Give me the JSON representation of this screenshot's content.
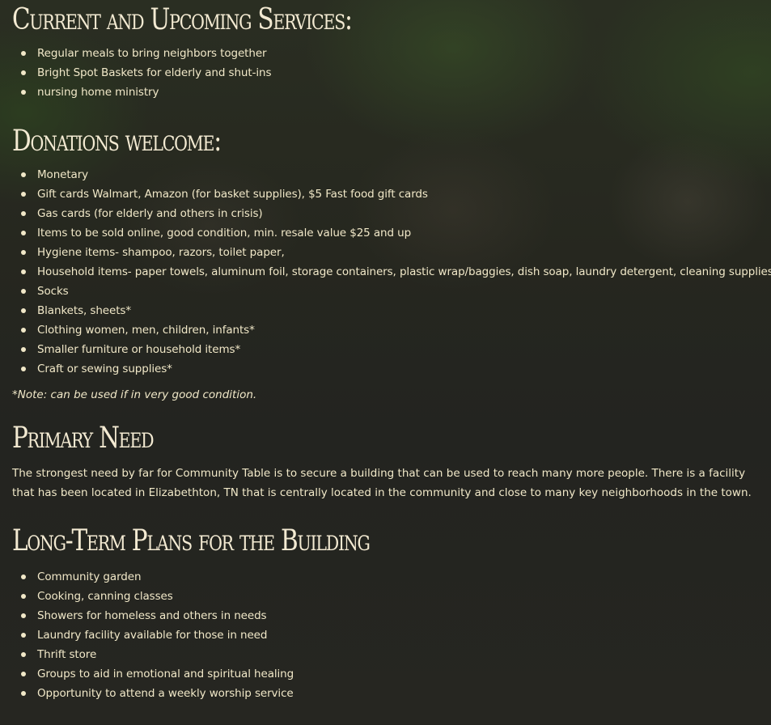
{
  "sections": {
    "services": {
      "title": "Current and Upcoming Services:",
      "items": [
        "Regular meals to bring neighbors together",
        "Bright Spot Baskets for elderly and shut-ins",
        "nursing home ministry"
      ]
    },
    "donations": {
      "title": "Donations welcome:",
      "items": [
        "Monetary",
        "Gift cards Walmart, Amazon (for basket supplies), $5 Fast food gift cards",
        "Gas cards (for elderly and others in crisis)",
        "Items to be sold online, good condition, min. resale value $25 and up",
        "Hygiene items- shampoo, razors, toilet paper,",
        "Household items- paper towels, aluminum foil, storage containers, plastic wrap/baggies, dish soap, laundry detergent, cleaning supplies",
        "Socks",
        "Blankets, sheets*",
        "Clothing women, men, children, infants*",
        "Smaller furniture or household items*",
        "Craft or sewing supplies*"
      ],
      "note": "*Note: can be used if in very good condition."
    },
    "primary_need": {
      "title": "Primary Need",
      "body": "The strongest need by far for Community Table is to secure a building that can be used to reach many more people. There is a facility that has been located in Elizabethton, TN that is centrally located in the community and close to many key neighborhoods in the town."
    },
    "long_term": {
      "title": "Long-Term Plans for the Building",
      "items": [
        "Community garden",
        "Cooking, canning classes",
        "Showers for homeless and others in needs",
        "Laundry facility available for those in need",
        "Thrift store",
        "Groups to aid in emotional and spiritual healing",
        "Opportunity to attend a weekly worship service"
      ]
    }
  },
  "colors": {
    "text": "#f1e8c8",
    "heading": "#f3ead2",
    "background": "#24241f"
  }
}
